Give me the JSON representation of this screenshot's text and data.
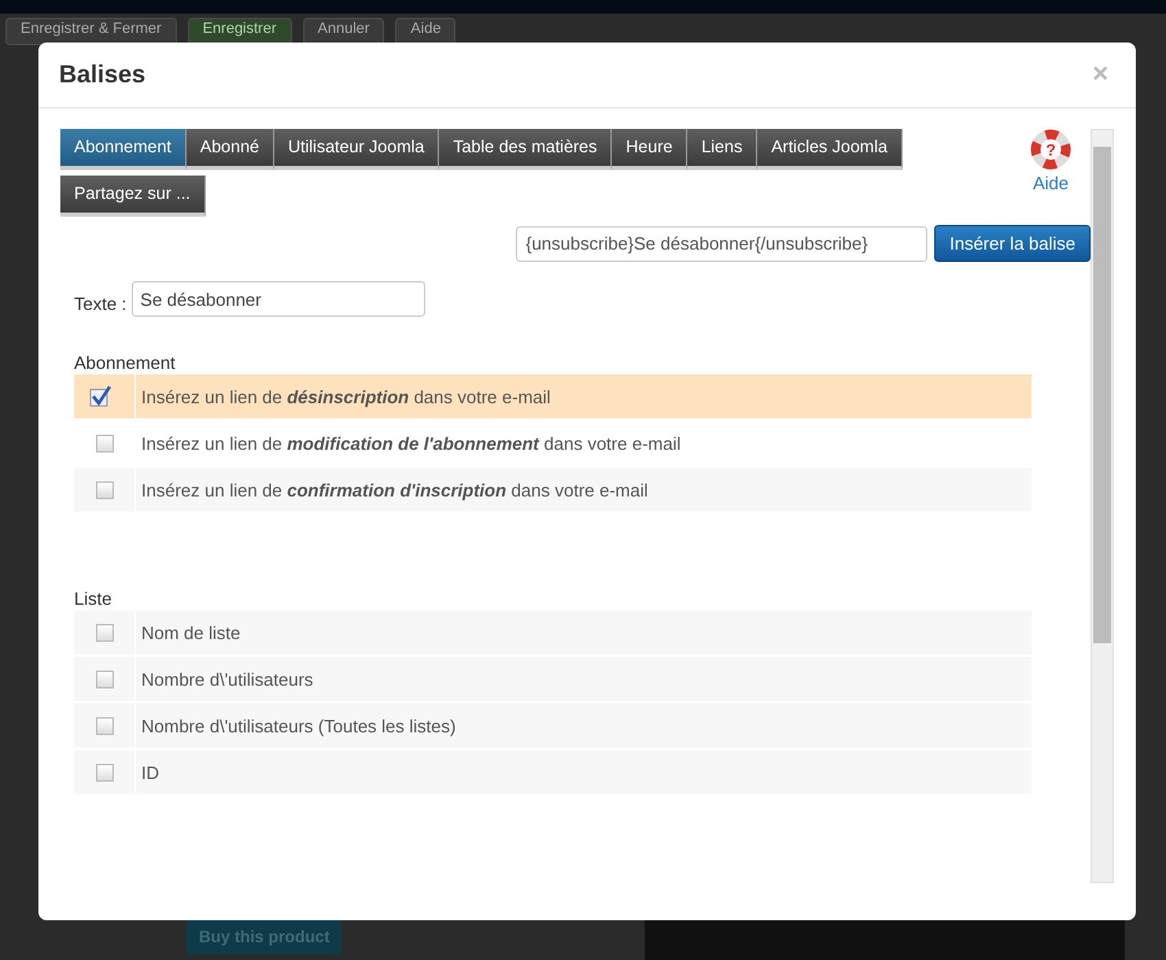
{
  "background": {
    "toolbar": [
      "Enregistrer & Fermer",
      "Enregistrer",
      "Annuler",
      "Aide"
    ],
    "buy_button": "Buy this product"
  },
  "modal": {
    "title": "Balises",
    "close": "×"
  },
  "tabs": [
    {
      "label": "Abonnement",
      "selected": true
    },
    {
      "label": "Abonné",
      "selected": false
    },
    {
      "label": "Utilisateur Joomla",
      "selected": false
    },
    {
      "label": "Table des matières",
      "selected": false
    },
    {
      "label": "Heure",
      "selected": false
    },
    {
      "label": "Liens",
      "selected": false
    },
    {
      "label": "Articles Joomla",
      "selected": false
    },
    {
      "label": "Partagez sur ...",
      "selected": false
    }
  ],
  "help": {
    "label": "Aide",
    "icon_mark": "?"
  },
  "insert": {
    "value": "{unsubscribe}Se désabonner{/unsubscribe}",
    "button": "Insérer la balise"
  },
  "text_field": {
    "label": "Texte :",
    "value": "Se désabonner"
  },
  "sections": [
    {
      "title": "Abonnement",
      "items": [
        {
          "text": "Insérez un lien de **désinscription** dans votre e-mail",
          "checked": true
        },
        {
          "text": "Insérez un lien de **modification de l'abonnement** dans votre e-mail",
          "checked": false
        },
        {
          "text": "Insérez un lien de **confirmation d'inscription** dans votre e-mail",
          "checked": false
        }
      ]
    },
    {
      "title": "Liste",
      "items": [
        {
          "text": "Nom de liste",
          "checked": false
        },
        {
          "text": "Nombre d\\'utilisateurs",
          "checked": false
        },
        {
          "text": "Nombre d\\'utilisateurs (Toutes les listes)",
          "checked": false
        },
        {
          "text": "ID",
          "checked": false
        }
      ]
    }
  ]
}
